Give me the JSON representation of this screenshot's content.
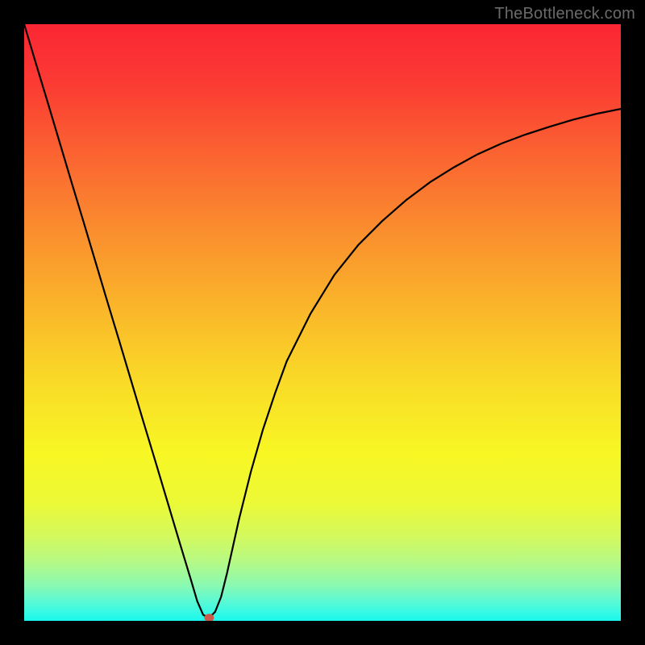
{
  "watermark": "TheBottleneck.com",
  "chart_data": {
    "type": "line",
    "title": "",
    "xlabel": "",
    "ylabel": "",
    "xlim": [
      0,
      100
    ],
    "ylim": [
      0,
      100
    ],
    "x": [
      0,
      2,
      4,
      6,
      8,
      10,
      12,
      14,
      16,
      18,
      20,
      22,
      24,
      26,
      28,
      29,
      30,
      31,
      32,
      33,
      34,
      36,
      38,
      40,
      42,
      44,
      48,
      52,
      56,
      60,
      64,
      68,
      72,
      76,
      80,
      84,
      88,
      92,
      96,
      100
    ],
    "values": [
      100,
      93.3,
      86.7,
      80.0,
      73.3,
      66.7,
      60.0,
      53.3,
      46.7,
      40.0,
      33.3,
      26.7,
      20.0,
      13.3,
      6.7,
      3.3,
      1.0,
      0.5,
      1.5,
      4.0,
      8.0,
      17.0,
      25.0,
      32.0,
      38.0,
      43.5,
      51.5,
      58.0,
      63.0,
      67.0,
      70.5,
      73.5,
      76.0,
      78.2,
      80.0,
      81.5,
      82.8,
      84.0,
      85.0,
      85.8
    ],
    "marker": {
      "x": 31,
      "y": 0.5
    },
    "gradient_stops": [
      {
        "offset": 0.0,
        "color": "#fb2634"
      },
      {
        "offset": 0.1,
        "color": "#fb3b33"
      },
      {
        "offset": 0.22,
        "color": "#fb6431"
      },
      {
        "offset": 0.35,
        "color": "#fa8f2e"
      },
      {
        "offset": 0.48,
        "color": "#fab72a"
      },
      {
        "offset": 0.6,
        "color": "#f9db27"
      },
      {
        "offset": 0.72,
        "color": "#f8f724"
      },
      {
        "offset": 0.8,
        "color": "#ecf935"
      },
      {
        "offset": 0.86,
        "color": "#d2f95e"
      },
      {
        "offset": 0.9,
        "color": "#b6f984"
      },
      {
        "offset": 0.94,
        "color": "#8bf9b1"
      },
      {
        "offset": 0.97,
        "color": "#55f9d7"
      },
      {
        "offset": 1.0,
        "color": "#19f9ef"
      }
    ]
  }
}
